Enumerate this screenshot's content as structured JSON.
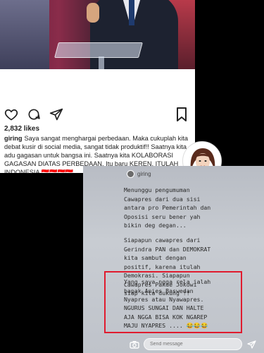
{
  "post": {
    "likes": "2,832 likes",
    "username": "giring",
    "caption": "Saya sangat menghargai perbedaan. Maka cukuplah kita debat kusir di social media, sangat tidak produktif!! Saatnya kita adu gagasan untuk bangsa ini. Saatnya kita KOLABORASI GAGASAN DIATAS PERBEDAAN. Itu baru KEREN, ITULAH INDONESIA",
    "flags": "🇮🇩🇮🇩🇮🇩🇮🇩",
    "icons": [
      "heart-icon",
      "comment-icon",
      "share-icon",
      "bookmark-icon"
    ]
  },
  "story": {
    "username": "giring",
    "paragraphs": [
      "Menunggu pengumuman\nCawapres dari dua sisi\nantara pro Pemerintah dan\nOposisi seru bener yah\nbikin deg degan...",
      "Siapapun cawapres dari\nGerindra PAN dan DEMOKRAT\nkita sambut dengan\npositif, karena itulah\nDemokrasi. Siapapun\nCawapres Pakde Jokowi\nsiap kita dukung !!",
      "Yang saya ngga rela ialah\nbapak Anies Baswedan\nNyapres atau Nyawapres.",
      "NGURUS SUNGAI DAN HALTE\nAJA NGGA BISA KOK NGAREP\nMAJU NYAPRES .... 😂😂😂"
    ],
    "reply_placeholder": "Send message",
    "highlight_color": "#e01b2e"
  }
}
